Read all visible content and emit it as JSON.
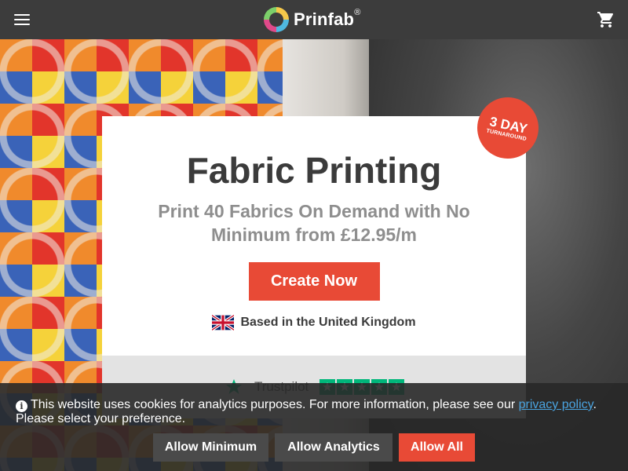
{
  "header": {
    "logo_text": "Prinfab",
    "logo_mark": "®",
    "menu_icon": "hamburger-menu-icon",
    "cart_icon": "shopping-cart-icon"
  },
  "hero": {
    "badge_line1": "3 DAY",
    "badge_line2": "TURNAROUND",
    "title": "Fabric Printing",
    "subtitle": "Print 40 Fabrics On Demand with No Minimum from £12.95/m",
    "cta_label": "Create Now",
    "country_text": "Based in the United Kingdom",
    "country_flag": "uk-flag-icon"
  },
  "trust": {
    "brand": "Trustpilot",
    "rating_stars": 5
  },
  "cookie": {
    "text_before": "This website uses cookies for analytics purposes. For more information, please see our ",
    "link_text": "privacy policy",
    "text_after": ". Please select your preference.",
    "buttons": {
      "minimum": "Allow Minimum",
      "analytics": "Allow Analytics",
      "all": "Allow All"
    }
  },
  "colors": {
    "accent": "#e84a36",
    "header_bg": "#3c3c3c",
    "link": "#4aa3df",
    "trustpilot_green": "#00b67a"
  }
}
